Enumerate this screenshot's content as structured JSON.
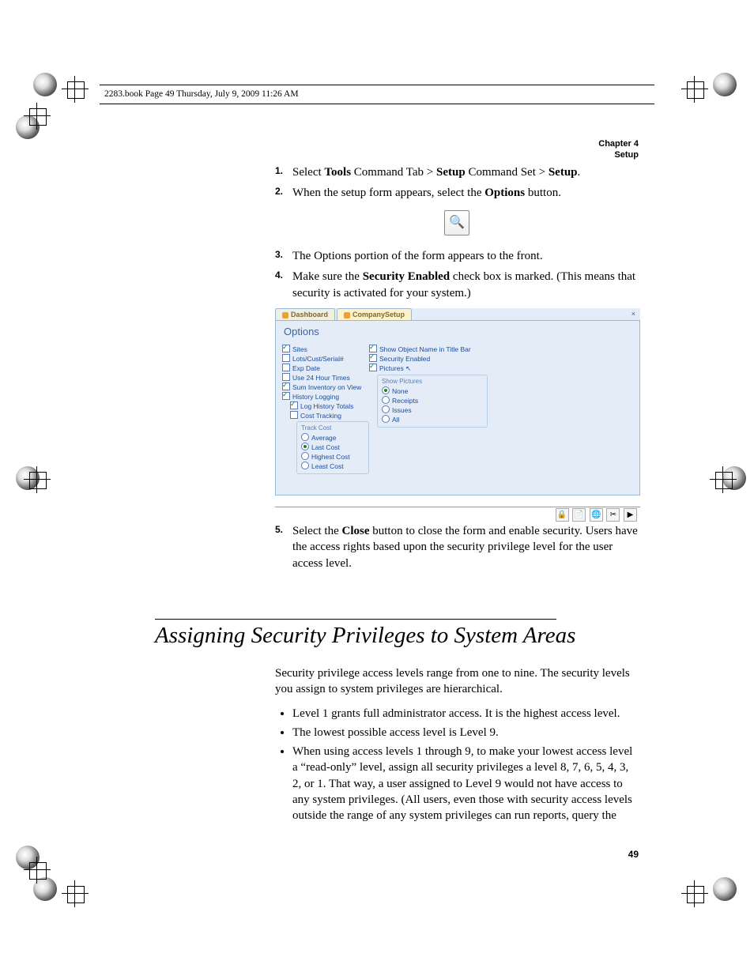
{
  "header": {
    "line_text": "2283.book  Page 49  Thursday, July 9, 2009  11:26 AM",
    "chapter": "Chapter 4",
    "chapter_title": "Setup",
    "page_number": "49"
  },
  "steps": {
    "s1_pre": "Select ",
    "s1_b1": "Tools",
    "s1_mid1": " Command Tab > ",
    "s1_b2": "Setup",
    "s1_mid2": " Command Set > ",
    "s1_b3": "Setup",
    "s1_post": ".",
    "s2_pre": "When the setup form appears, select the ",
    "s2_b": "Options",
    "s2_post": " button.",
    "s3": "The Options portion of the form appears to the front.",
    "s4_pre": "Make sure the ",
    "s4_b": "Security Enabled",
    "s4_post": " check box is marked. (This means that security is activated for your system.)",
    "s5_pre": "Select the ",
    "s5_b": "Close",
    "s5_post": " button to close the form and enable security. Users have the access rights based upon the security privilege level for the user access level."
  },
  "figure": {
    "tab1": "Dashboard",
    "tab2": "CompanySetup",
    "title": "Options",
    "left": {
      "sites": "Sites",
      "lots": "Lots/Cust/Serial#",
      "exp": "Exp Date",
      "use24": "Use 24 Hour Times",
      "suminv": "Sum Inventory on View",
      "histlog": "History Logging",
      "loghist": "Log History Totals",
      "costtrack": "Cost Tracking",
      "trackcost_title": "Track Cost",
      "avg": "Average",
      "last": "Last Cost",
      "highest": "Highest Cost",
      "least": "Least Cost"
    },
    "right": {
      "showobj": "Show Object Name in Title Bar",
      "secenabled": "Security Enabled",
      "pictures": "Pictures",
      "showpics_title": "Show Pictures",
      "none": "None",
      "receipts": "Receipts",
      "issues": "Issues",
      "all": "All"
    },
    "toolbar": [
      "🔒",
      "📄",
      "🌐",
      "✂",
      "▶"
    ]
  },
  "section": {
    "title": "Assigning Security Privileges to System Areas",
    "intro": "Security privilege access levels range from one to nine. The security levels you assign to system privileges are hierarchical.",
    "b1": "Level 1 grants full administrator access. It is the highest access level.",
    "b2": "The lowest possible access level is Level 9.",
    "b3": "When using access levels 1 through 9, to make your lowest access level a “read-only” level, assign all security privileges a level 8, 7, 6, 5, 4, 3, 2, or 1. That way, a user assigned to Level 9 would not have access to any system privileges. (All users, even those with security access levels outside the range of any system privileges can run reports, query the"
  }
}
